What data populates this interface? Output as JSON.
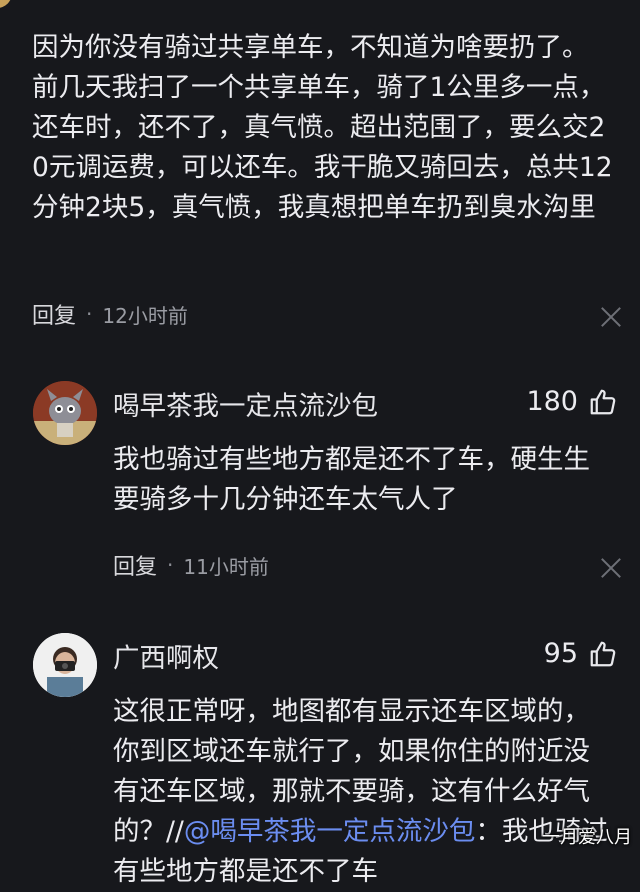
{
  "main_comment": {
    "text": "因为你没有骑过共享单车，不知道为啥要扔了。 前几天我扫了一个共享单车，骑了1公里多一点，还车时，还不了，真气愤。超出范围了，要么交20元调运费，可以还车。我干脆又骑回去，总共12分钟2块5，真气愤，我真想把单车扔到臭水沟里",
    "reply_label": "回复",
    "separator": "·",
    "time": "12小时前"
  },
  "replies": [
    {
      "username": "喝早茶我一定点流沙包",
      "likes": "180",
      "text": "我也骑过有些地方都是还不了车，硬生生要骑多十几分钟还车太气人了",
      "reply_label": "回复",
      "separator": "·",
      "time": "11小时前"
    },
    {
      "username": "广西啊权",
      "likes": "95",
      "text_before_mention": "这很正常呀，地图都有显示还车区域的，你到区域还车就行了，如果你住的附近没有还车区域，那就不要骑，这有什么好气的？//",
      "mention": "@喝早茶我一定点流沙包",
      "text_after_mention": "：我也骑过有些地方都是还不了车"
    }
  ],
  "watermark": "一月爱八月",
  "colors": {
    "background": "#17181c",
    "text": "#ececf0",
    "meta": "#9a9ca3",
    "mention": "#6b8df0"
  },
  "icons": [
    "thumbs-up-icon",
    "close-icon"
  ]
}
